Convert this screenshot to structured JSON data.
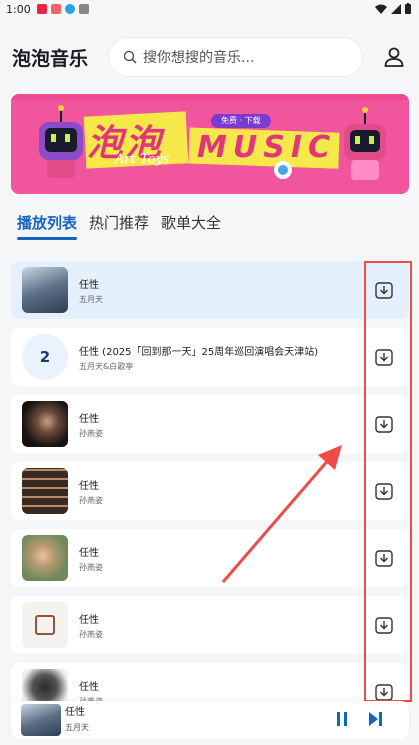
{
  "status": {
    "time": "1:00"
  },
  "app": {
    "title": "泡泡音乐",
    "search_placeholder": "搜你想搜的音乐..."
  },
  "banner": {
    "title_cn": "泡泡",
    "title_en": "MUSIC",
    "script_text": "Art Toys",
    "badge": "免费 · 下载"
  },
  "tabs": [
    {
      "label": "播放列表",
      "active": true
    },
    {
      "label": "热门推荐",
      "active": false
    },
    {
      "label": "歌单大全",
      "active": false
    }
  ],
  "songs": [
    {
      "title": "任性",
      "artist": "五月天",
      "thumb": "photo-blue"
    },
    {
      "title": "任性 (2025「回到那一天」25周年巡回演唱会天津站)",
      "artist": "五月天&白歌亭",
      "badge": "2"
    },
    {
      "title": "任性",
      "artist": "孙燕姿",
      "thumb": "photo-dark"
    },
    {
      "title": "任性",
      "artist": "孙燕姿",
      "thumb": "photo-collage"
    },
    {
      "title": "任性",
      "artist": "孙燕姿",
      "thumb": "photo-green"
    },
    {
      "title": "任性",
      "artist": "孙燕姿",
      "thumb": "photo-logo"
    },
    {
      "title": "任性",
      "artist": "孙燕姿",
      "thumb": "photo-bird"
    }
  ],
  "player": {
    "title": "任性",
    "artist": "五月天"
  },
  "colors": {
    "accent": "#1565c0",
    "highlight": "#ef4b4b",
    "banner": "#f0559e"
  }
}
